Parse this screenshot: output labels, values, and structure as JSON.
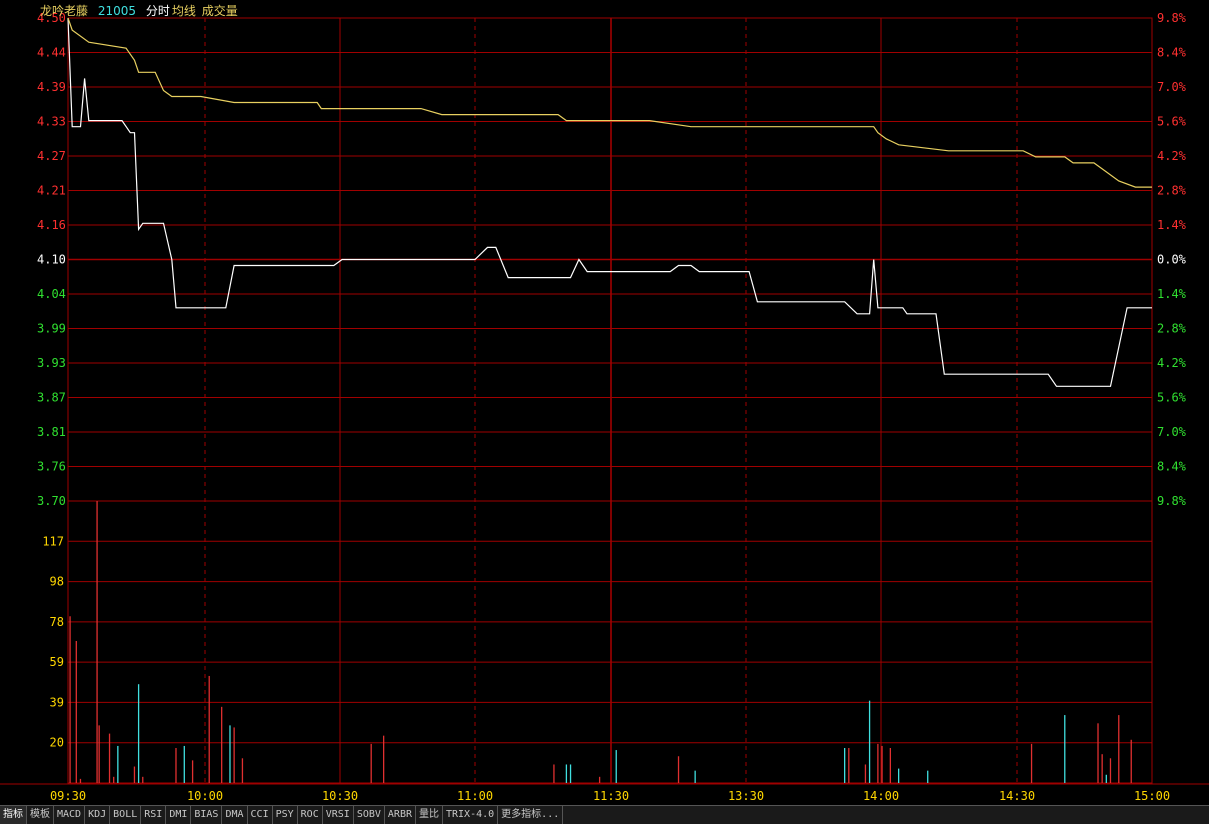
{
  "header": {
    "stock_name": "龙吟老藤",
    "stock_code": "21005",
    "label_fenshi": "分时",
    "label_junxian": "均线",
    "label_volume": "成交量"
  },
  "colors": {
    "price_line": "#ffffff",
    "avg_line": "#e8d060",
    "grid": "#a00000",
    "up": "#ff3030",
    "down": "#30e030",
    "neutral": "#ffffff",
    "volume_label": "#ffd700",
    "vol_up": "#e03030",
    "vol_down": "#40e0e0"
  },
  "price_axis": {
    "labels": [
      "4.50",
      "4.44",
      "4.39",
      "4.33",
      "4.27",
      "4.21",
      "4.16",
      "4.10",
      "4.04",
      "3.99",
      "3.93",
      "3.87",
      "3.81",
      "3.76",
      "3.70"
    ],
    "reference_price": 4.1
  },
  "pct_axis": {
    "labels": [
      "9.8%",
      "8.4%",
      "7.0%",
      "5.6%",
      "4.2%",
      "2.8%",
      "1.4%",
      "0.0%",
      "1.4%",
      "2.8%",
      "4.2%",
      "5.6%",
      "7.0%",
      "8.4%",
      "9.8%"
    ]
  },
  "volume_axis": {
    "labels": [
      "117",
      "98",
      "78",
      "59",
      "39",
      "20"
    ]
  },
  "time_axis": {
    "labels": [
      "09:30",
      "10:00",
      "10:30",
      "11:00",
      "11:30",
      "13:30",
      "14:00",
      "14:30",
      "15:00"
    ]
  },
  "chart_data": [
    {
      "type": "line",
      "title": "分时",
      "ylim": [
        3.7,
        4.5
      ],
      "x_range_minutes": [
        0,
        240
      ],
      "series": [
        {
          "name": "分时",
          "points": [
            [
              0,
              4.5
            ],
            [
              1,
              4.32
            ],
            [
              3,
              4.32
            ],
            [
              4,
              4.4
            ],
            [
              5,
              4.33
            ],
            [
              13,
              4.33
            ],
            [
              15,
              4.31
            ],
            [
              16,
              4.31
            ],
            [
              17,
              4.15
            ],
            [
              18,
              4.16
            ],
            [
              23,
              4.16
            ],
            [
              25,
              4.1
            ],
            [
              26,
              4.02
            ],
            [
              38,
              4.02
            ],
            [
              40,
              4.09
            ],
            [
              64,
              4.09
            ],
            [
              66,
              4.1
            ],
            [
              98,
              4.1
            ],
            [
              101,
              4.12
            ],
            [
              103,
              4.12
            ],
            [
              106,
              4.07
            ],
            [
              121,
              4.07
            ],
            [
              123,
              4.1
            ],
            [
              125,
              4.08
            ],
            [
              145,
              4.08
            ],
            [
              147,
              4.09
            ],
            [
              150,
              4.09
            ],
            [
              152,
              4.08
            ],
            [
              164,
              4.08
            ],
            [
              166,
              4.03
            ],
            [
              187,
              4.03
            ],
            [
              190,
              4.01
            ],
            [
              193,
              4.01
            ],
            [
              194,
              4.1
            ],
            [
              195,
              4.02
            ],
            [
              201,
              4.02
            ],
            [
              202,
              4.01
            ],
            [
              209,
              4.01
            ],
            [
              211,
              3.91
            ],
            [
              236,
              3.91
            ],
            [
              238,
              3.89
            ],
            [
              251,
              3.89
            ],
            [
              255,
              4.02
            ],
            [
              261,
              4.02
            ]
          ]
        },
        {
          "name": "均线",
          "points": [
            [
              0,
              4.5
            ],
            [
              1,
              4.48
            ],
            [
              5,
              4.46
            ],
            [
              14,
              4.45
            ],
            [
              16,
              4.43
            ],
            [
              17,
              4.41
            ],
            [
              21,
              4.41
            ],
            [
              23,
              4.38
            ],
            [
              25,
              4.37
            ],
            [
              32,
              4.37
            ],
            [
              40,
              4.36
            ],
            [
              48,
              4.36
            ],
            [
              60,
              4.36
            ],
            [
              61,
              4.35
            ],
            [
              85,
              4.35
            ],
            [
              90,
              4.34
            ],
            [
              100,
              4.34
            ],
            [
              110,
              4.34
            ],
            [
              118,
              4.34
            ],
            [
              120,
              4.33
            ],
            [
              140,
              4.33
            ],
            [
              150,
              4.32
            ],
            [
              170,
              4.32
            ],
            [
              194,
              4.32
            ],
            [
              195,
              4.31
            ],
            [
              197,
              4.3
            ],
            [
              200,
              4.29
            ],
            [
              212,
              4.28
            ],
            [
              230,
              4.28
            ],
            [
              233,
              4.27
            ],
            [
              240,
              4.27
            ],
            [
              242,
              4.26
            ],
            [
              247,
              4.26
            ],
            [
              249,
              4.25
            ],
            [
              253,
              4.23
            ],
            [
              257,
              4.22
            ],
            [
              261,
              4.22
            ]
          ]
        }
      ]
    },
    {
      "type": "bar",
      "title": "成交量",
      "ylim": [
        0,
        137
      ],
      "series": [
        {
          "name": "成交量",
          "points": [
            [
              0.5,
              81,
              "up"
            ],
            [
              2,
              69,
              "up"
            ],
            [
              3,
              2,
              "up"
            ],
            [
              7,
              137,
              "up"
            ],
            [
              7.5,
              28,
              "up"
            ],
            [
              10,
              24,
              "up"
            ],
            [
              11,
              3,
              "up"
            ],
            [
              12,
              18,
              "down"
            ],
            [
              16,
              8,
              "up"
            ],
            [
              17,
              48,
              "down"
            ],
            [
              18,
              3,
              "up"
            ],
            [
              26,
              17,
              "up"
            ],
            [
              28,
              18,
              "down"
            ],
            [
              30,
              11,
              "up"
            ],
            [
              34,
              52,
              "up"
            ],
            [
              37,
              37,
              "up"
            ],
            [
              39,
              28,
              "down"
            ],
            [
              40,
              27,
              "up"
            ],
            [
              42,
              12,
              "up"
            ],
            [
              73,
              19,
              "up"
            ],
            [
              76,
              23,
              "up"
            ],
            [
              117,
              9,
              "up"
            ],
            [
              120,
              9,
              "down"
            ],
            [
              121,
              9,
              "down"
            ],
            [
              128,
              3,
              "up"
            ],
            [
              132,
              16,
              "down"
            ],
            [
              147,
              13,
              "up"
            ],
            [
              151,
              6,
              "down"
            ],
            [
              187,
              17,
              "down"
            ],
            [
              188,
              17,
              "up"
            ],
            [
              192,
              9,
              "up"
            ],
            [
              193,
              40,
              "down"
            ],
            [
              195,
              19,
              "up"
            ],
            [
              196,
              18,
              "up"
            ],
            [
              198,
              17,
              "up"
            ],
            [
              200,
              7,
              "down"
            ],
            [
              207,
              6,
              "down"
            ],
            [
              232,
              19,
              "up"
            ],
            [
              240,
              33,
              "down"
            ],
            [
              248,
              29,
              "up"
            ],
            [
              249,
              14,
              "up"
            ],
            [
              250,
              4,
              "down"
            ],
            [
              251,
              12,
              "up"
            ],
            [
              253,
              33,
              "up"
            ],
            [
              256,
              21,
              "up"
            ]
          ]
        }
      ]
    }
  ],
  "tabs": [
    "指标",
    "模板",
    "MACD",
    "KDJ",
    "BOLL",
    "RSI",
    "DMI",
    "BIAS",
    "DMA",
    "CCI",
    "PSY",
    "ROC",
    "VRSI",
    "SOBV",
    "ARBR",
    "量比",
    "TRIX-4.0",
    "更多指标..."
  ]
}
